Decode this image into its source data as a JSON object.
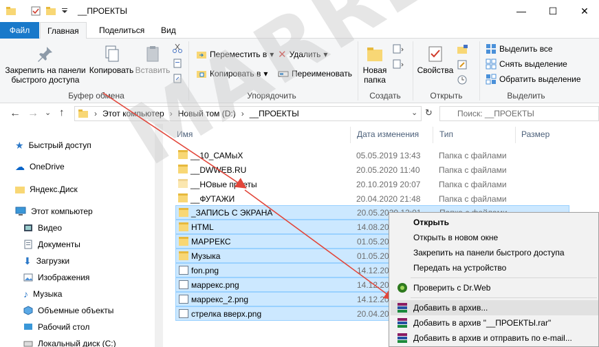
{
  "window": {
    "title": "__ПРОЕКТЫ",
    "minimize": "—",
    "maximize": "☐",
    "close": "✕"
  },
  "tabs": [
    {
      "label": "Файл"
    },
    {
      "label": "Главная"
    },
    {
      "label": "Поделиться"
    },
    {
      "label": "Вид"
    }
  ],
  "ribbon": {
    "clipboard": {
      "pin": "Закрепить на панели быстрого доступа",
      "pin_line1": "Закрепить на панели",
      "pin_line2": "быстрого доступа",
      "copy": "Копировать",
      "paste": "Вставить",
      "group": "Буфер обмена"
    },
    "organize": {
      "move": "Переместить в",
      "delete": "Удалить",
      "copyto": "Копировать в",
      "rename": "Переименовать",
      "group": "Упорядочить"
    },
    "create": {
      "newfolder_line1": "Новая",
      "newfolder_line2": "папка",
      "group": "Создать"
    },
    "open": {
      "properties": "Свойства",
      "group": "Открыть"
    },
    "select": {
      "selectall": "Выделить все",
      "selectnone": "Снять выделение",
      "invert": "Обратить выделение",
      "group": "Выделить"
    }
  },
  "address": {
    "crumbs": [
      "Этот компьютер",
      "Новый том (D:)",
      "__ПРОЕКТЫ"
    ],
    "search_placeholder": "Поиск: __ПРОЕКТЫ"
  },
  "nav": [
    {
      "label": "Быстрый доступ"
    },
    {
      "label": "OneDrive"
    },
    {
      "label": "Яндекс.Диск"
    },
    {
      "label": "Этот компьютер"
    },
    {
      "label": "Видео"
    },
    {
      "label": "Документы"
    },
    {
      "label": "Загрузки"
    },
    {
      "label": "Изображения"
    },
    {
      "label": "Музыка"
    },
    {
      "label": "Объемные объекты"
    },
    {
      "label": "Рабочий стол"
    },
    {
      "label": "Локальный диск (C:)"
    }
  ],
  "columns": {
    "name": "Имя",
    "date": "Дата изменения",
    "type": "Тип",
    "size": "Размер"
  },
  "files": [
    {
      "name": "__10_САМыХ",
      "date": "05.05.2019 13:43",
      "type": "Папка с файлами"
    },
    {
      "name": "__DWWEB.RU",
      "date": "20.05.2020 11:40",
      "type": "Папка с файлами"
    },
    {
      "name": "__НОвые проеты",
      "date": "20.10.2019 20:07",
      "type": "Папка с файлами"
    },
    {
      "name": "__ФУТАЖИ",
      "date": "20.04.2020 21:48",
      "type": "Папка с файлами"
    },
    {
      "name": "_ЗАПИСЬ С ЭКРАНА",
      "date": "20.05.2020 12:01",
      "type": "Папка с файлами"
    },
    {
      "name": "HTML",
      "date": "14.08.2019",
      "type": ""
    },
    {
      "name": "МАРРЕКС",
      "date": "01.05.2020",
      "type": ""
    },
    {
      "name": "Музыка",
      "date": "01.05.2020",
      "type": ""
    },
    {
      "name": "fon.png",
      "date": "14.12.2019",
      "type": ""
    },
    {
      "name": "маррекс.png",
      "date": "14.12.2019",
      "type": ""
    },
    {
      "name": "маррекс_2.png",
      "date": "14.12.2019",
      "type": ""
    },
    {
      "name": "стрелка вверх.png",
      "date": "20.04.2020",
      "type": ""
    }
  ],
  "context_menu": {
    "open": "Открыть",
    "open_new": "Открыть в новом окне",
    "pin_quick": "Закрепить на панели быстрого доступа",
    "send_device": "Передать на устройство",
    "drweb": "Проверить с Dr.Web",
    "add_archive": "Добавить в архив...",
    "add_rar": "Добавить в архив \"__ПРОЕКТЫ.rar\"",
    "add_email": "Добавить в архив и отправить по e-mail..."
  },
  "watermark": "MARREX.RU",
  "colors": {
    "accent": "#1979ca",
    "selection": "#cce8ff",
    "arrow": "#e2463a"
  }
}
